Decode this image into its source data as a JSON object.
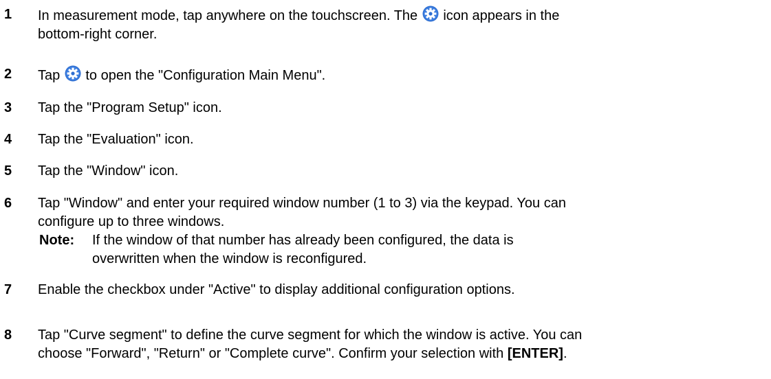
{
  "steps": [
    {
      "number": "1",
      "text_a": "In measurement mode, tap anywhere on the touchscreen. The",
      "icon": "gear-icon",
      "text_b": "icon appears in the",
      "text_c": "bottom-right corner."
    },
    {
      "number": "2",
      "text_a": "Tap",
      "icon": "gear-icon",
      "text_b": "to open the \"Configuration Main Menu\"."
    },
    {
      "number": "3",
      "text": "Tap the \"Program Setup\" icon."
    },
    {
      "number": "4",
      "text": "Tap the \"Evaluation\" icon."
    },
    {
      "number": "5",
      "text": "Tap the \"Window\" icon."
    },
    {
      "number": "6",
      "line1": "Tap \"Window\" and enter your required window number (1 to 3) via the keypad. You can",
      "line2": "configure up to three windows.",
      "note_label": "Note:",
      "note_line1": "If the window of that number has already been configured, the data is",
      "note_line2": "overwritten when the window is reconfigured."
    },
    {
      "number": "7",
      "text": "Enable the checkbox under \"Active\" to display additional configuration options."
    },
    {
      "number": "8",
      "line1": "Tap \"Curve segment\" to define the curve segment for which the window is active. You can",
      "line2_a": "choose \"Forward\", \"Return\" or \"Complete curve\". Confirm your selection with",
      "line2_key": "[ENTER]",
      "line2_end": "."
    }
  ],
  "colors": {
    "text": "#000000",
    "icon_fill": "#2f6fd1",
    "icon_glyph": "#ffffff"
  }
}
